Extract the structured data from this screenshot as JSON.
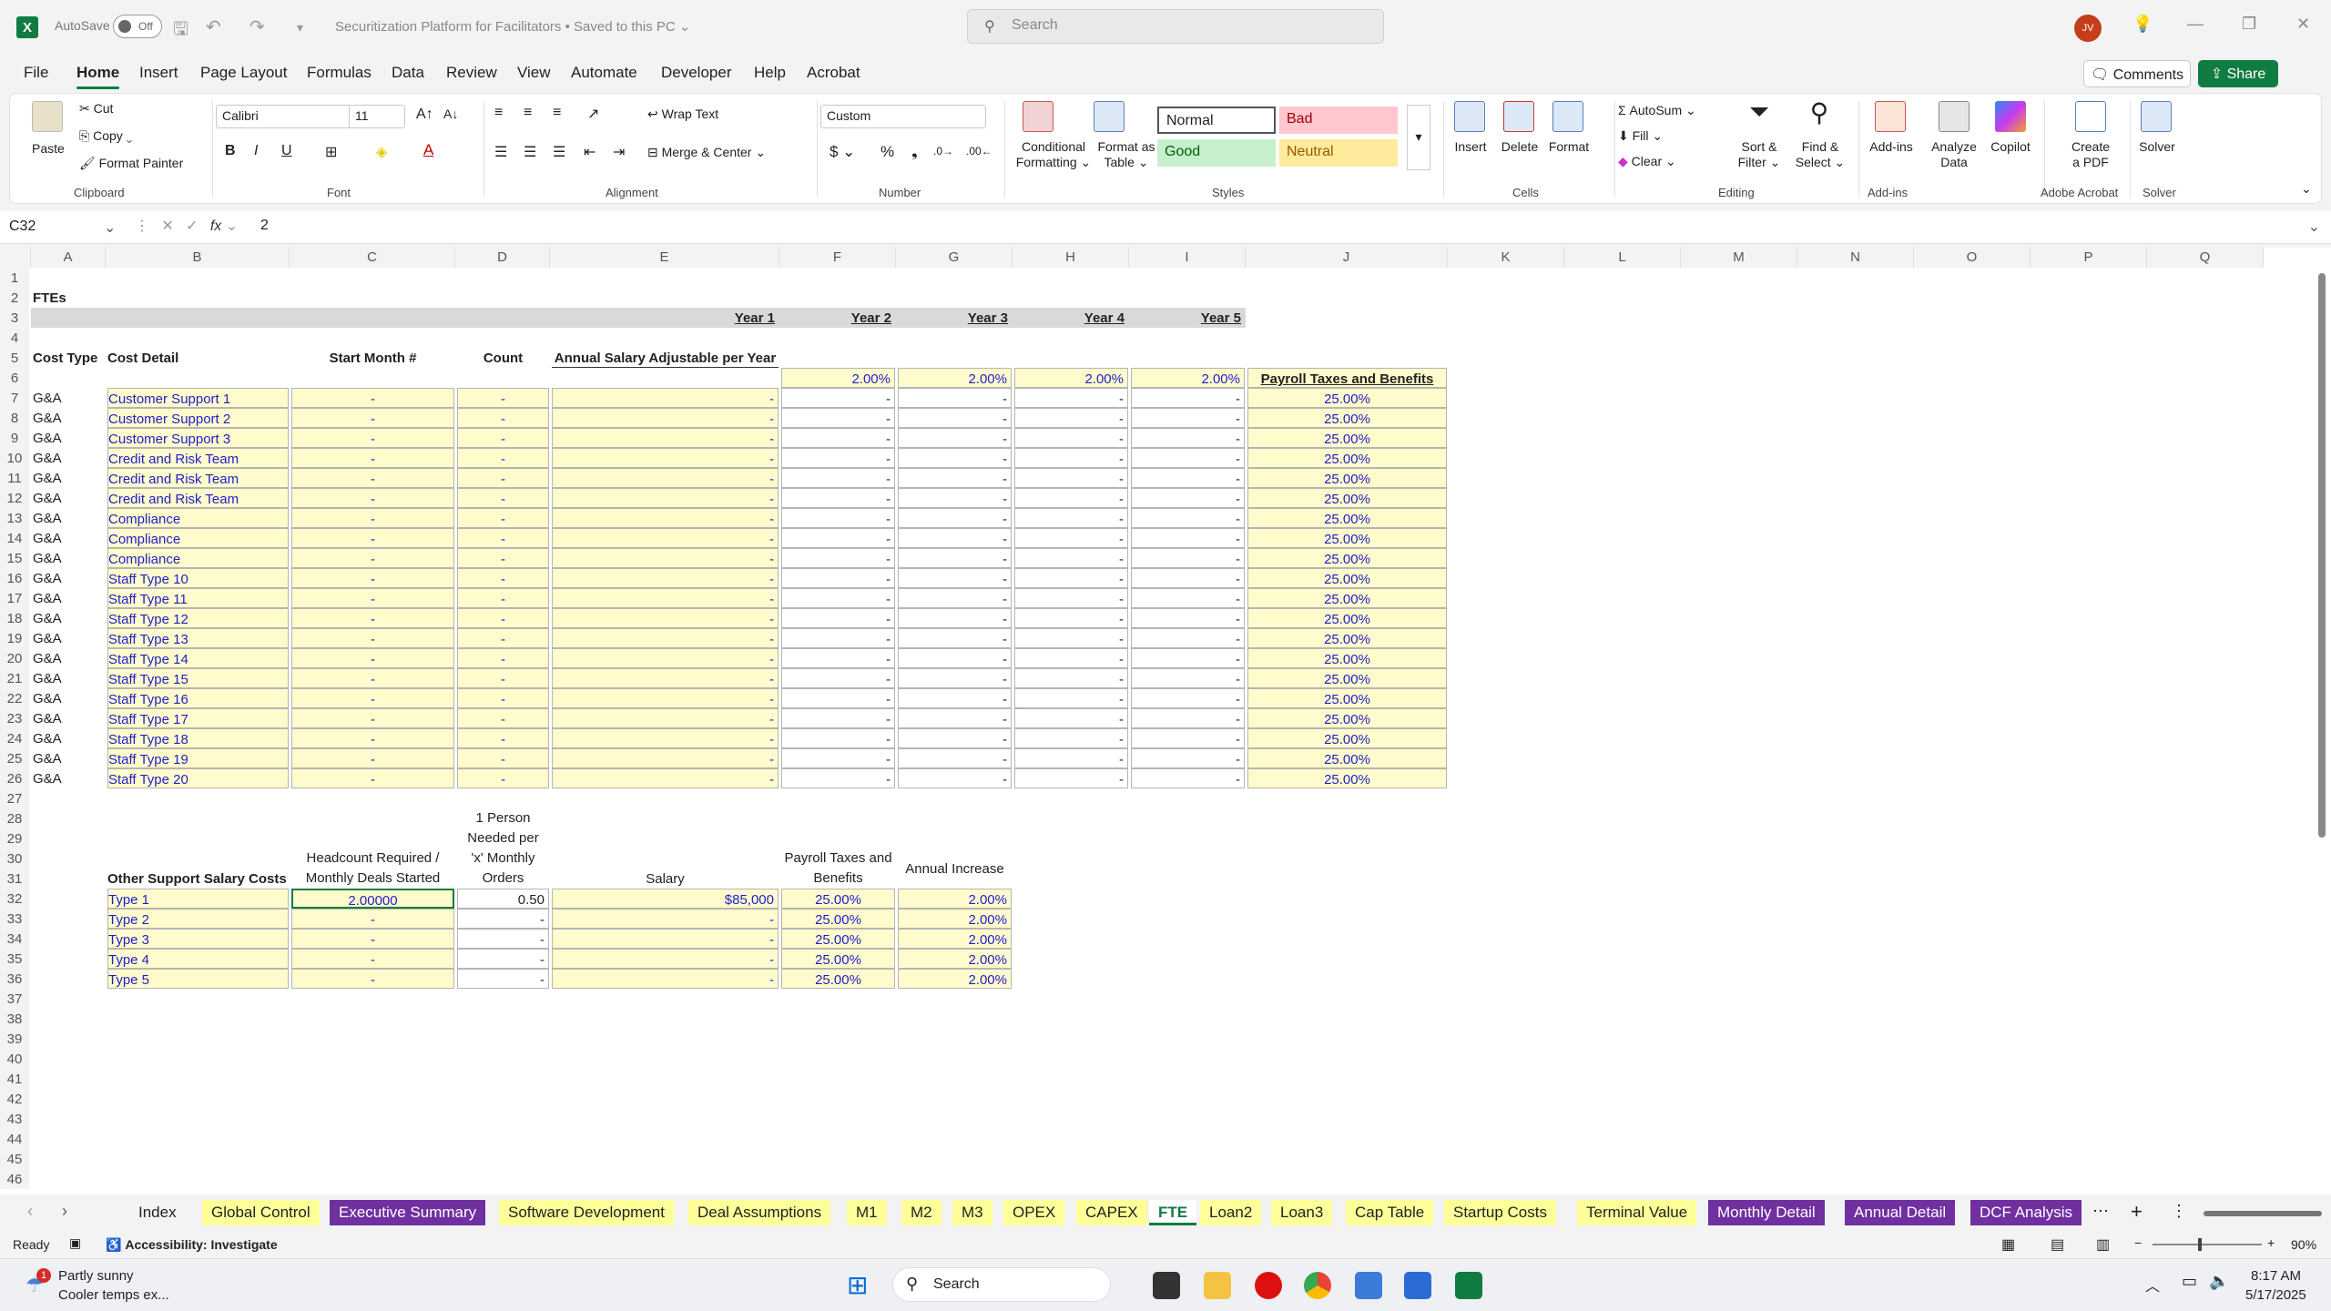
{
  "titlebar": {
    "autosave_label": "AutoSave",
    "autosave_state": "Off",
    "doc_title": "Securitization Platform for Facilitators • Saved to this PC ⌄",
    "search_placeholder": "Search",
    "user_initials": "JV"
  },
  "menu": {
    "tabs": [
      "File",
      "Home",
      "Insert",
      "Page Layout",
      "Formulas",
      "Data",
      "Review",
      "View",
      "Automate",
      "Developer",
      "Help",
      "Acrobat"
    ],
    "active": "Home",
    "comments": "Comments",
    "share": "Share"
  },
  "ribbon": {
    "clipboard": {
      "paste": "Paste",
      "cut": "Cut",
      "copy": "Copy",
      "format_painter": "Format Painter",
      "label": "Clipboard"
    },
    "font": {
      "name": "Calibri",
      "size": "11",
      "label": "Font"
    },
    "alignment": {
      "wrap": "Wrap Text",
      "merge": "Merge & Center",
      "label": "Alignment"
    },
    "number": {
      "format": "Custom",
      "label": "Number"
    },
    "styles": {
      "cond": "Conditional Formatting",
      "cond1": "Conditional",
      "cond2": "Formatting ⌄",
      "table1": "Format as",
      "table2": "Table ⌄",
      "normal": "Normal",
      "bad": "Bad",
      "good": "Good",
      "neutral": "Neutral",
      "label": "Styles"
    },
    "cells": {
      "insert": "Insert",
      "delete": "Delete",
      "format": "Format",
      "label": "Cells"
    },
    "editing": {
      "autosum": "AutoSum",
      "fill": "Fill",
      "clear": "Clear",
      "sort1": "Sort &",
      "sort2": "Filter ⌄",
      "find1": "Find &",
      "find2": "Select ⌄",
      "label": "Editing"
    },
    "addins": {
      "addins": "Add-ins",
      "analyze1": "Analyze",
      "analyze2": "Data",
      "copilot": "Copilot",
      "label": "Add-ins"
    },
    "acrobat": {
      "create1": "Create",
      "create2": "a PDF",
      "label": "Adobe Acrobat"
    },
    "solver": {
      "solver": "Solver",
      "label": "Solver"
    }
  },
  "formula_bar": {
    "name_box": "C32",
    "value": "2"
  },
  "columns": [
    "A",
    "B",
    "C",
    "D",
    "E",
    "F",
    "G",
    "H",
    "I",
    "J",
    "K",
    "L",
    "M",
    "N",
    "O",
    "P",
    "Q"
  ],
  "sheet": {
    "title": "FTEs",
    "years": [
      "Year 1",
      "Year 2",
      "Year 3",
      "Year 4",
      "Year 5"
    ],
    "header_row": {
      "cost_type": "Cost Type",
      "cost_detail": "Cost Detail",
      "start_month": "Start Month #",
      "count": "Count",
      "annual_salary": "Annual Salary Adjustable per Year"
    },
    "row6": {
      "adjust": [
        "2.00%",
        "2.00%",
        "2.00%",
        "2.00%"
      ],
      "payroll_hdr": "Payroll Taxes and Benefits"
    },
    "fte_rows": [
      {
        "type": "G&A",
        "detail": "Customer Support 1"
      },
      {
        "type": "G&A",
        "detail": "Customer Support 2"
      },
      {
        "type": "G&A",
        "detail": "Customer Support 3"
      },
      {
        "type": "G&A",
        "detail": "Credit and Risk Team"
      },
      {
        "type": "G&A",
        "detail": "Credit and Risk Team"
      },
      {
        "type": "G&A",
        "detail": "Credit and Risk Team"
      },
      {
        "type": "G&A",
        "detail": "Compliance"
      },
      {
        "type": "G&A",
        "detail": "Compliance"
      },
      {
        "type": "G&A",
        "detail": "Compliance"
      },
      {
        "type": "G&A",
        "detail": "Staff Type 10"
      },
      {
        "type": "G&A",
        "detail": "Staff Type 11"
      },
      {
        "type": "G&A",
        "detail": "Staff Type 12"
      },
      {
        "type": "G&A",
        "detail": "Staff Type 13"
      },
      {
        "type": "G&A",
        "detail": "Staff Type 14"
      },
      {
        "type": "G&A",
        "detail": "Staff Type 15"
      },
      {
        "type": "G&A",
        "detail": "Staff Type 16"
      },
      {
        "type": "G&A",
        "detail": "Staff Type 17"
      },
      {
        "type": "G&A",
        "detail": "Staff Type 18"
      },
      {
        "type": "G&A",
        "detail": "Staff Type 19"
      },
      {
        "type": "G&A",
        "detail": "Staff Type 20"
      }
    ],
    "dash": "-",
    "payroll_value": "25.00%",
    "support": {
      "header_b": "Other Support Salary Costs",
      "header_c": [
        "Headcount Required /",
        "Monthly Deals Started"
      ],
      "header_d": [
        "1 Person",
        "Needed per",
        "'x' Monthly",
        "Orders"
      ],
      "header_e": "Salary",
      "header_f": [
        "Payroll Taxes and",
        "Benefits"
      ],
      "header_g": "Annual Increase",
      "rows": [
        {
          "type": "Type 1",
          "headcount": "2.00000",
          "orders": "0.50",
          "salary": "$85,000",
          "payroll": "25.00%",
          "increase": "2.00%"
        },
        {
          "type": "Type 2",
          "headcount": "-",
          "orders": "-",
          "salary": "-",
          "payroll": "25.00%",
          "increase": "2.00%"
        },
        {
          "type": "Type 3",
          "headcount": "-",
          "orders": "-",
          "salary": "-",
          "payroll": "25.00%",
          "increase": "2.00%"
        },
        {
          "type": "Type 4",
          "headcount": "-",
          "orders": "-",
          "salary": "-",
          "payroll": "25.00%",
          "increase": "2.00%"
        },
        {
          "type": "Type 5",
          "headcount": "-",
          "orders": "-",
          "salary": "-",
          "payroll": "25.00%",
          "increase": "2.00%"
        }
      ]
    }
  },
  "sheet_tabs": [
    {
      "name": "Index",
      "style": "plain"
    },
    {
      "name": "Global Control",
      "style": "yel"
    },
    {
      "name": "Executive Summary",
      "style": "pur"
    },
    {
      "name": "Software Development",
      "style": "yel"
    },
    {
      "name": "Deal Assumptions",
      "style": "yel"
    },
    {
      "name": "M1",
      "style": "yel"
    },
    {
      "name": "M2",
      "style": "yel"
    },
    {
      "name": "M3",
      "style": "yel"
    },
    {
      "name": "OPEX",
      "style": "yel"
    },
    {
      "name": "CAPEX",
      "style": "yel"
    },
    {
      "name": "FTE",
      "style": "active"
    },
    {
      "name": "Loan2",
      "style": "yel"
    },
    {
      "name": "Loan3",
      "style": "yel"
    },
    {
      "name": "Cap Table",
      "style": "yel"
    },
    {
      "name": "Startup Costs",
      "style": "yel"
    },
    {
      "name": "Terminal Value",
      "style": "yel"
    },
    {
      "name": "Monthly Detail",
      "style": "pur"
    },
    {
      "name": "Annual Detail",
      "style": "pur"
    },
    {
      "name": "DCF Analysis",
      "style": "pur"
    }
  ],
  "status": {
    "ready": "Ready",
    "accessibility": "Accessibility: Investigate",
    "zoom": "90%"
  },
  "taskbar": {
    "weather1": "Partly sunny",
    "weather2": "Cooler temps ex...",
    "search": "Search",
    "time": "8:17 AM",
    "date": "5/17/2025",
    "badge": "1"
  }
}
